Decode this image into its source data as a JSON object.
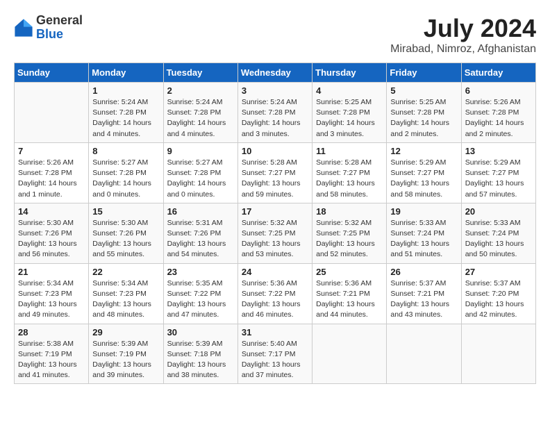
{
  "header": {
    "logo_general": "General",
    "logo_blue": "Blue",
    "month_year": "July 2024",
    "location": "Mirabad, Nimroz, Afghanistan"
  },
  "days_of_week": [
    "Sunday",
    "Monday",
    "Tuesday",
    "Wednesday",
    "Thursday",
    "Friday",
    "Saturday"
  ],
  "weeks": [
    [
      {
        "day": "",
        "content": ""
      },
      {
        "day": "1",
        "content": "Sunrise: 5:24 AM\nSunset: 7:28 PM\nDaylight: 14 hours\nand 4 minutes."
      },
      {
        "day": "2",
        "content": "Sunrise: 5:24 AM\nSunset: 7:28 PM\nDaylight: 14 hours\nand 4 minutes."
      },
      {
        "day": "3",
        "content": "Sunrise: 5:24 AM\nSunset: 7:28 PM\nDaylight: 14 hours\nand 3 minutes."
      },
      {
        "day": "4",
        "content": "Sunrise: 5:25 AM\nSunset: 7:28 PM\nDaylight: 14 hours\nand 3 minutes."
      },
      {
        "day": "5",
        "content": "Sunrise: 5:25 AM\nSunset: 7:28 PM\nDaylight: 14 hours\nand 2 minutes."
      },
      {
        "day": "6",
        "content": "Sunrise: 5:26 AM\nSunset: 7:28 PM\nDaylight: 14 hours\nand 2 minutes."
      }
    ],
    [
      {
        "day": "7",
        "content": "Sunrise: 5:26 AM\nSunset: 7:28 PM\nDaylight: 14 hours\nand 1 minute."
      },
      {
        "day": "8",
        "content": "Sunrise: 5:27 AM\nSunset: 7:28 PM\nDaylight: 14 hours\nand 0 minutes."
      },
      {
        "day": "9",
        "content": "Sunrise: 5:27 AM\nSunset: 7:28 PM\nDaylight: 14 hours\nand 0 minutes."
      },
      {
        "day": "10",
        "content": "Sunrise: 5:28 AM\nSunset: 7:27 PM\nDaylight: 13 hours\nand 59 minutes."
      },
      {
        "day": "11",
        "content": "Sunrise: 5:28 AM\nSunset: 7:27 PM\nDaylight: 13 hours\nand 58 minutes."
      },
      {
        "day": "12",
        "content": "Sunrise: 5:29 AM\nSunset: 7:27 PM\nDaylight: 13 hours\nand 58 minutes."
      },
      {
        "day": "13",
        "content": "Sunrise: 5:29 AM\nSunset: 7:27 PM\nDaylight: 13 hours\nand 57 minutes."
      }
    ],
    [
      {
        "day": "14",
        "content": "Sunrise: 5:30 AM\nSunset: 7:26 PM\nDaylight: 13 hours\nand 56 minutes."
      },
      {
        "day": "15",
        "content": "Sunrise: 5:30 AM\nSunset: 7:26 PM\nDaylight: 13 hours\nand 55 minutes."
      },
      {
        "day": "16",
        "content": "Sunrise: 5:31 AM\nSunset: 7:26 PM\nDaylight: 13 hours\nand 54 minutes."
      },
      {
        "day": "17",
        "content": "Sunrise: 5:32 AM\nSunset: 7:25 PM\nDaylight: 13 hours\nand 53 minutes."
      },
      {
        "day": "18",
        "content": "Sunrise: 5:32 AM\nSunset: 7:25 PM\nDaylight: 13 hours\nand 52 minutes."
      },
      {
        "day": "19",
        "content": "Sunrise: 5:33 AM\nSunset: 7:24 PM\nDaylight: 13 hours\nand 51 minutes."
      },
      {
        "day": "20",
        "content": "Sunrise: 5:33 AM\nSunset: 7:24 PM\nDaylight: 13 hours\nand 50 minutes."
      }
    ],
    [
      {
        "day": "21",
        "content": "Sunrise: 5:34 AM\nSunset: 7:23 PM\nDaylight: 13 hours\nand 49 minutes."
      },
      {
        "day": "22",
        "content": "Sunrise: 5:34 AM\nSunset: 7:23 PM\nDaylight: 13 hours\nand 48 minutes."
      },
      {
        "day": "23",
        "content": "Sunrise: 5:35 AM\nSunset: 7:22 PM\nDaylight: 13 hours\nand 47 minutes."
      },
      {
        "day": "24",
        "content": "Sunrise: 5:36 AM\nSunset: 7:22 PM\nDaylight: 13 hours\nand 46 minutes."
      },
      {
        "day": "25",
        "content": "Sunrise: 5:36 AM\nSunset: 7:21 PM\nDaylight: 13 hours\nand 44 minutes."
      },
      {
        "day": "26",
        "content": "Sunrise: 5:37 AM\nSunset: 7:21 PM\nDaylight: 13 hours\nand 43 minutes."
      },
      {
        "day": "27",
        "content": "Sunrise: 5:37 AM\nSunset: 7:20 PM\nDaylight: 13 hours\nand 42 minutes."
      }
    ],
    [
      {
        "day": "28",
        "content": "Sunrise: 5:38 AM\nSunset: 7:19 PM\nDaylight: 13 hours\nand 41 minutes."
      },
      {
        "day": "29",
        "content": "Sunrise: 5:39 AM\nSunset: 7:19 PM\nDaylight: 13 hours\nand 39 minutes."
      },
      {
        "day": "30",
        "content": "Sunrise: 5:39 AM\nSunset: 7:18 PM\nDaylight: 13 hours\nand 38 minutes."
      },
      {
        "day": "31",
        "content": "Sunrise: 5:40 AM\nSunset: 7:17 PM\nDaylight: 13 hours\nand 37 minutes."
      },
      {
        "day": "",
        "content": ""
      },
      {
        "day": "",
        "content": ""
      },
      {
        "day": "",
        "content": ""
      }
    ]
  ]
}
